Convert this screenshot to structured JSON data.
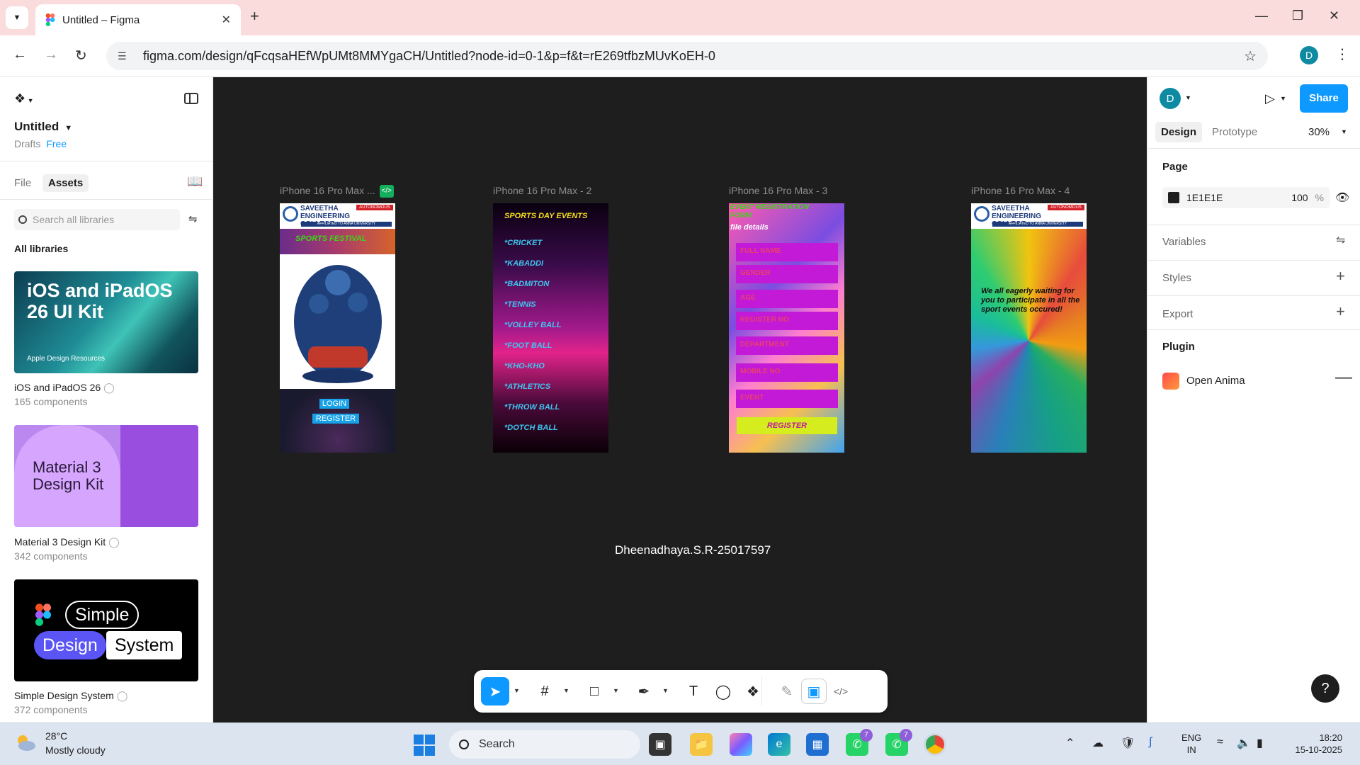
{
  "browser": {
    "tab_title": "Untitled – Figma",
    "url": "figma.com/design/qFcqsaHEfWpUMt8MMYgaCH/Untitled?node-id=0-1&p=f&t=rE269tfbzMUvKoEH-0",
    "profile_initial": "D"
  },
  "left_panel": {
    "file_title": "Untitled",
    "location": "Drafts",
    "plan": "Free",
    "tabs": [
      "File",
      "Assets"
    ],
    "active_tab": "Assets",
    "search_placeholder": "Search all libraries",
    "section_title": "All libraries",
    "libraries": [
      {
        "name": "iOS and iPadOS 26",
        "count": "165 components",
        "card_title": "iOS and iPadOS 26 UI Kit",
        "card_sub": "Apple Design Resources"
      },
      {
        "name": "Material 3 Design Kit",
        "count": "342 components",
        "card_title": "Material 3 Design Kit"
      },
      {
        "name": "Simple Design System",
        "count": "372 components",
        "pills": [
          "Simple",
          "Design",
          "System"
        ]
      }
    ]
  },
  "canvas": {
    "frames": [
      {
        "label": "iPhone 16 Pro Max ...",
        "college": "SAVEETHA ENGINEERING COLLEGE",
        "autonomous": "AUTONOMOUS",
        "affiliation": "AFFILIATED TO ANNA UNIVERSITY",
        "festival": "SPORTS FESTIVAL",
        "login": "LOGIN",
        "register": "REGISTER"
      },
      {
        "label": "iPhone 16 Pro Max - 2",
        "heading": "SPORTS DAY EVENTS",
        "events": [
          "*CRICKET",
          "*KABADDI",
          "*BADMITON",
          "*TENNIS",
          "*VOLLEY BALL",
          "*FOOT BALL",
          "*KHO-KHO",
          "*ATHLETICS",
          "*THROW BALL",
          "*DOTCH BALL"
        ]
      },
      {
        "label": "iPhone 16 Pro Max - 3",
        "heading": "EVENT REGISTRATION FORM",
        "subheading": "file details",
        "fields": [
          "FULL NAME",
          "GENDER",
          "AGE",
          "REGISTER NO",
          "DEPARTMENT",
          "MOBILE NO",
          "EVENT"
        ],
        "register": "REGISTER"
      },
      {
        "label": "iPhone 16 Pro Max - 4",
        "college": "SAVEETHA ENGINEERING COLLEGE",
        "autonomous": "AUTONOMOUS",
        "affiliation": "AFFILIATED TO ANNA UNIVERSITY",
        "message": "We all eagerly waiting for you to participate in all the sport events occured!"
      }
    ],
    "name_text": "Dheenadhaya.S.R-25017597"
  },
  "right_panel": {
    "avatar": "D",
    "share": "Share",
    "tabs": [
      "Design",
      "Prototype"
    ],
    "active_tab": "Design",
    "zoom": "30%",
    "page_label": "Page",
    "page_color": "1E1E1E",
    "page_opacity": "100",
    "page_opacity_unit": "%",
    "sections": [
      "Variables",
      "Styles",
      "Export"
    ],
    "plugin_label": "Plugin",
    "plugin_name": "Open Anima",
    "help": "?"
  },
  "taskbar": {
    "temperature": "28°C",
    "condition": "Mostly cloudy",
    "search": "Search",
    "whatsapp_badge": "7",
    "lang_1": "ENG",
    "lang_2": "IN",
    "time": "18:20",
    "date": "15-10-2025"
  },
  "colors": {
    "figma_blue": "#0d99ff",
    "canvas_bg": "#1e1e1e",
    "tab_bar": "#fbdcdc"
  }
}
